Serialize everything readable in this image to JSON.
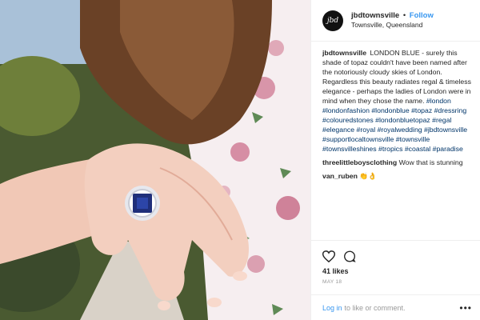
{
  "post": {
    "username": "jbdtownsville",
    "separator": "•",
    "follow_label": "Follow",
    "location": "Townsville, Queensland",
    "avatar_text": "jbd",
    "caption_text": "LONDON BLUE - surely this shade of topaz couldn't have been named after the notoriously cloudy skies of London. Regardless this beauty radiates regal & timeless elegance - perhaps the ladies of London were in mind when they chose the name.",
    "hashtags": "#london #londonfashion #londonblue #topaz #dressring #colouredstones #londonbluetopaz #regal #elegance #royal #royalwedding #jbdtownsville #supportlocaltownsville #townsville #townsvilleshines #tropics #coastal #paradise",
    "comments": [
      {
        "username": "threelittleboysclothing",
        "text": "Wow that is stunning"
      },
      {
        "username": "van_ruben",
        "text": "👏👌"
      }
    ],
    "likes": "41 likes",
    "date": "MAY 18",
    "icons": {
      "like": "heart-icon",
      "comment": "comment-icon",
      "more": "more-options-icon"
    }
  },
  "footer": {
    "login_link": "Log in",
    "login_text": "to like or comment.",
    "more_label": "•••"
  },
  "colors": {
    "link_blue": "#3897f0",
    "hashtag": "#003569",
    "muted": "#999999"
  }
}
